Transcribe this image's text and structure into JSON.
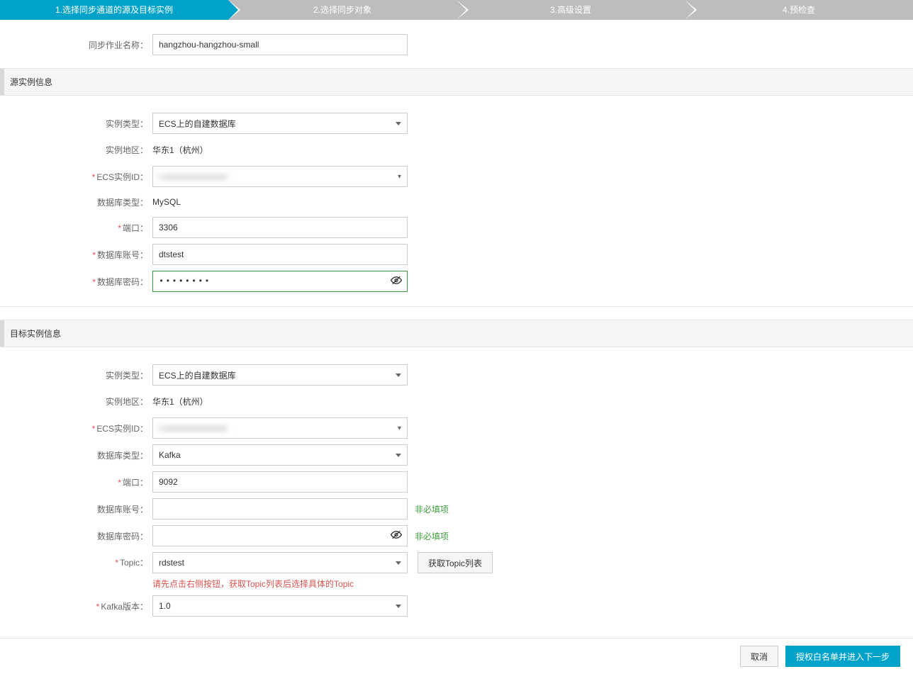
{
  "steps": {
    "s1": "1.选择同步通道的源及目标实例",
    "s2": "2.选择同步对象",
    "s3": "3.高级设置",
    "s4": "4.预检查"
  },
  "labels": {
    "job_name": "同步作业名称：",
    "instance_type": "实例类型：",
    "instance_region": "实例地区：",
    "ecs_id": "ECS实例ID：",
    "db_type": "数据库类型：",
    "port": "端口：",
    "db_account": "数据库账号：",
    "db_password": "数据库密码：",
    "topic": "Topic：",
    "kafka_version": "Kafka版本："
  },
  "section": {
    "source": "源实例信息",
    "target": "目标实例信息"
  },
  "source": {
    "job_name_value": "hangzhou-hangzhou-small",
    "instance_type": "ECS上的自建数据库",
    "instance_region": "华东1（杭州）",
    "ecs_id_masked": "i-xxxxxxxxxxxxxxx",
    "db_type": "MySQL",
    "port": "3306",
    "db_account": "dtstest",
    "db_password_dots": "••••••••"
  },
  "target": {
    "instance_type": "ECS上的自建数据库",
    "instance_region": "华东1（杭州）",
    "ecs_id_masked": "i-xxxxxxxxxxxxxxx",
    "db_type": "Kafka",
    "port": "9092",
    "db_account": "",
    "db_password": "",
    "topic": "rdstest",
    "kafka_version": "1.0"
  },
  "hints": {
    "optional": "非必填项",
    "topic_hint": "请先点击右侧按钮，获取Topic列表后选择具体的Topic"
  },
  "buttons": {
    "get_topic": "获取Topic列表",
    "cancel": "取消",
    "next": "授权白名单并进入下一步"
  },
  "icons": {
    "eye": "👁"
  }
}
